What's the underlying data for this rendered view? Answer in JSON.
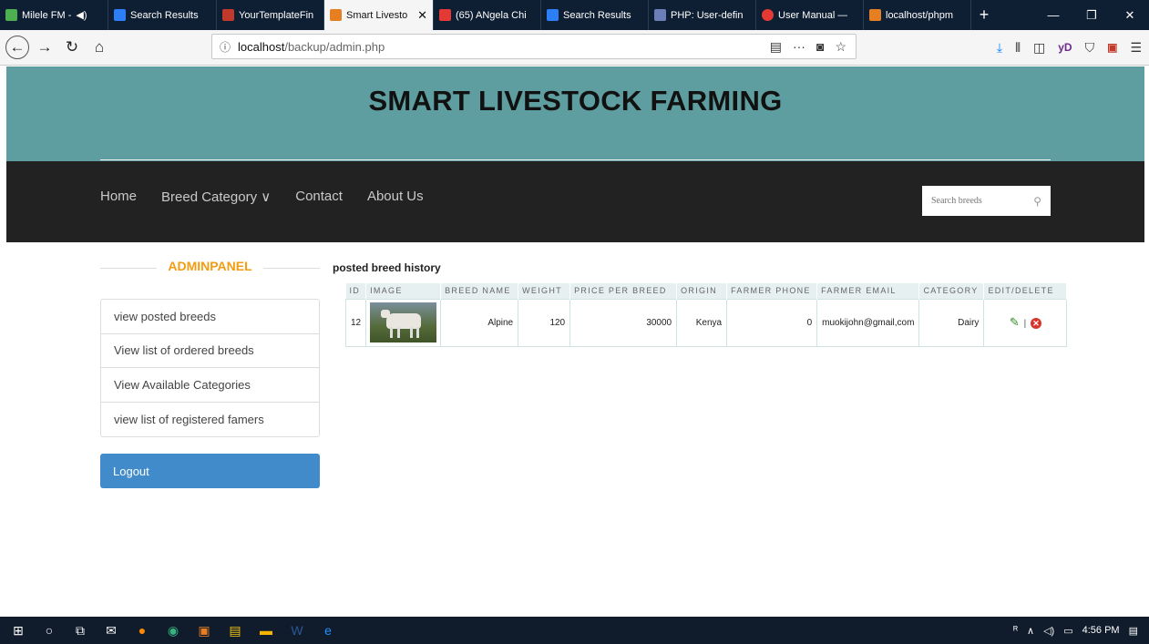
{
  "browser": {
    "tabs": [
      {
        "label": "Milele FM - ",
        "color": "#4caf50",
        "active": false
      },
      {
        "label": "Search Results",
        "color": "#2d7ff9",
        "active": false
      },
      {
        "label": "YourTemplateFin",
        "color": "#c0392b",
        "active": false
      },
      {
        "label": "Smart Livesto",
        "color": "#e67e22",
        "active": true
      },
      {
        "label": "(65) ANgela Chi",
        "color": "#e53935",
        "active": false
      },
      {
        "label": "Search Results",
        "color": "#2d7ff9",
        "active": false
      },
      {
        "label": "PHP: User-defin",
        "color": "#6c7eb7",
        "active": false
      },
      {
        "label": "User Manual — ",
        "color": "#e53935",
        "active": false
      },
      {
        "label": "localhost/phpm",
        "color": "#e67e22",
        "active": false
      }
    ],
    "url_host": "localhost",
    "url_path": "/backup/admin.php"
  },
  "site": {
    "title": "SMART LIVESTOCK FARMING",
    "nav": {
      "home": "Home",
      "breed_category": "Breed Category ∨",
      "contact": "Contact",
      "about": "About Us"
    },
    "search_placeholder": "Search breeds"
  },
  "admin": {
    "panel_title": "ADMINPANEL",
    "menu": [
      "view posted breeds",
      "View list of ordered breeds",
      "View Available Categories",
      "view list of registered famers"
    ],
    "logout": "Logout"
  },
  "history": {
    "title": "posted breed history",
    "columns": [
      "ID",
      "IMAGE",
      "BREED NAME",
      "WEIGHT",
      "PRICE PER BREED",
      "ORIGIN",
      "FARMER PHONE",
      "FARMER EMAIL",
      "CATEGORY",
      "EDIT/DELETE"
    ],
    "rows": [
      {
        "id": "12",
        "breed": "Alpine",
        "weight": "120",
        "price": "30000",
        "origin": "Kenya",
        "phone": "0",
        "email": "muokijohn@gmail,com",
        "category": "Dairy",
        "separator": "|"
      }
    ]
  },
  "taskbar": {
    "time": "4:56 PM"
  }
}
